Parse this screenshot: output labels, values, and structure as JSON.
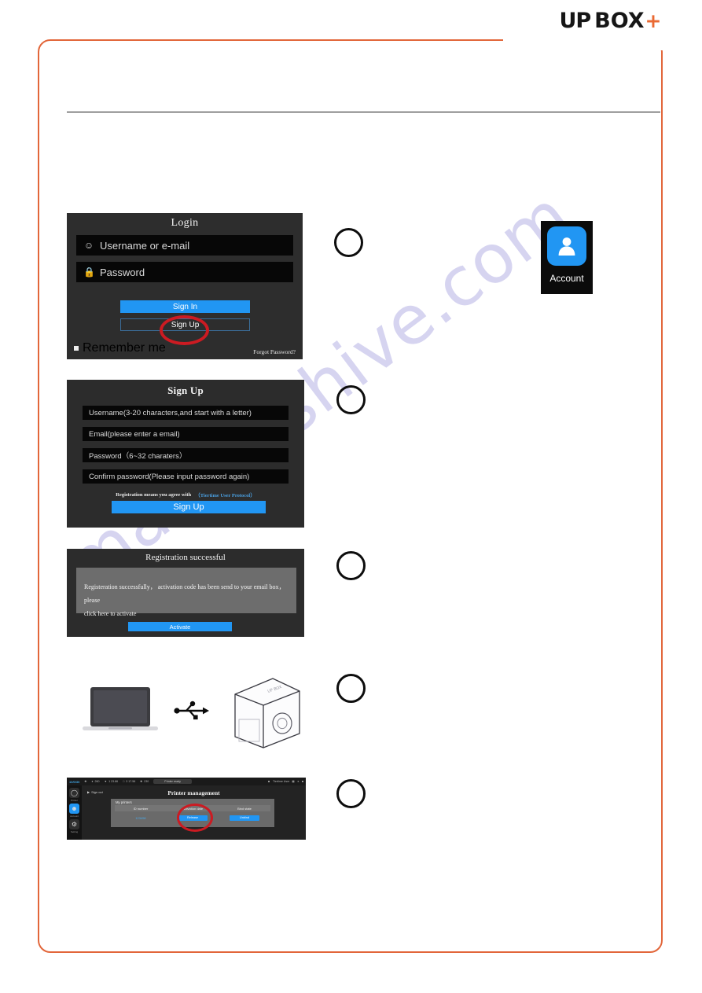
{
  "brand": {
    "up": "UP",
    "box": "BOX",
    "plus": "+"
  },
  "watermark": {
    "text": "manualshive.com"
  },
  "login_panel": {
    "title": "Login",
    "username_placeholder": "Username or e-mail",
    "password_placeholder": "Password",
    "user_icon": "user-icon",
    "lock_icon": "lock-icon",
    "sign_in_label": "Sign In",
    "sign_up_label": "Sign Up",
    "remember_label": "Remember me",
    "forgot_label": "Forgot Password?"
  },
  "signup_panel": {
    "title": "Sign Up",
    "fields": [
      "Username(3-20 characters,and start with a letter)",
      "Email(please enter a email)",
      "Password（6~32 charaters）",
      "Confirm password(Please input password again)"
    ],
    "protocol_note": "Registration means you agree with",
    "protocol_link": "（Tiertime User Protocol）",
    "sign_up_label": "Sign Up"
  },
  "registration_panel": {
    "title": "Registration successful",
    "body_line1": "Registeration successfully， activation code has been send to your email box， please",
    "body_line2": "click here to activate",
    "activate_label": "Activate"
  },
  "account_tile": {
    "label": "Account",
    "icon": "person-icon"
  },
  "hardware": {
    "laptop_icon": "laptop-icon",
    "usb_icon": "usb-icon",
    "printer_icon": "3d-printer-icon"
  },
  "printer_management": {
    "topbar": {
      "coord": "10/0/30",
      "nozzle_icon": "nozzle-icon",
      "nozzle_value": "260",
      "temp_icon": "temperature-icon",
      "temp_value": "1   23.86",
      "layer_icon": "layer-icon",
      "layer_value": "3   17.56",
      "bed_icon": "bed-icon",
      "bed_value": "230",
      "status": "Printer ready",
      "account_name": "Tiertime User",
      "icons": [
        "user-icon",
        "grid-icon",
        "share-icon",
        "delete-icon"
      ]
    },
    "sidebar": [
      {
        "label": "Printer",
        "icon": "printer-icon"
      },
      {
        "label": "Account",
        "icon": "account-icon"
      },
      {
        "label": "Setting",
        "icon": "gear-icon"
      }
    ],
    "sign_out_label": "Sign out",
    "title": "Printer management",
    "card_title": "My printers",
    "columns": [
      "ID number",
      "Activation date",
      "Bind state"
    ],
    "row": {
      "id": "123456",
      "release_button": "Release",
      "unbind_button": "Unbind"
    }
  },
  "steps": [
    {
      "number": ""
    },
    {
      "number": ""
    },
    {
      "number": ""
    },
    {
      "number": ""
    },
    {
      "number": ""
    }
  ]
}
